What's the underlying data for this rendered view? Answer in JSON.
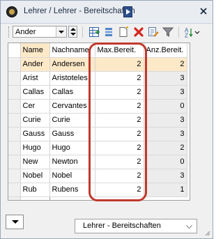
{
  "window": {
    "title": "Lehrer / Lehrer - Bereitschaften"
  },
  "toolbar": {
    "teacher_select": "Ander",
    "icons": [
      "new-record-icon",
      "list-icon",
      "new-document-icon",
      "delete-icon",
      "edit-form-icon",
      "filter-icon",
      "sort-icon"
    ]
  },
  "table": {
    "columns": [
      "Name",
      "Nachname",
      "Max.Bereit.",
      "Anz.Bereit."
    ],
    "rows": [
      {
        "name": "Ander",
        "nachname": "Andersen",
        "max": "2",
        "anz": "2"
      },
      {
        "name": "Arist",
        "nachname": "Aristoteles",
        "max": "2",
        "anz": "3"
      },
      {
        "name": "Callas",
        "nachname": "Callas",
        "max": "2",
        "anz": "3"
      },
      {
        "name": "Cer",
        "nachname": "Cervantes",
        "max": "2",
        "anz": "0"
      },
      {
        "name": "Curie",
        "nachname": "Curie",
        "max": "2",
        "anz": "3"
      },
      {
        "name": "Gauss",
        "nachname": "Gauss",
        "max": "2",
        "anz": "3"
      },
      {
        "name": "Hugo",
        "nachname": "Hugo",
        "max": "2",
        "anz": "2"
      },
      {
        "name": "New",
        "nachname": "Newton",
        "max": "2",
        "anz": "0"
      },
      {
        "name": "Nobel",
        "nachname": "Nobel",
        "max": "2",
        "anz": "3"
      },
      {
        "name": "Rub",
        "nachname": "Rubens",
        "max": "2",
        "anz": "1"
      }
    ],
    "selected_row": 0
  },
  "bottom": {
    "view_select": "Lehrer - Bereitschaften"
  },
  "colors": {
    "selection": "#fde9c8",
    "annotation": "#c0392b"
  }
}
